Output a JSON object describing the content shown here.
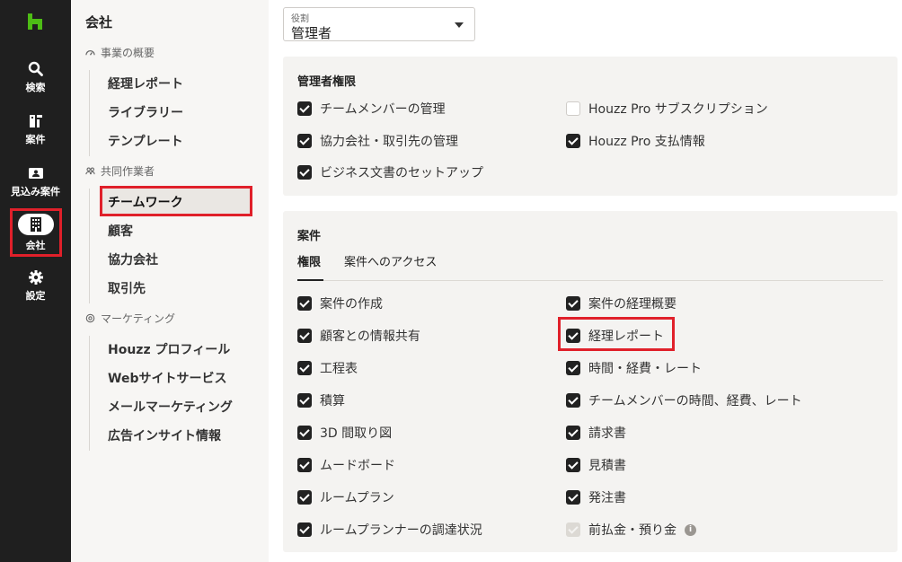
{
  "rail": {
    "items": [
      {
        "label": "検索",
        "icon": "search-icon"
      },
      {
        "label": "案件",
        "icon": "projects-icon"
      },
      {
        "label": "見込み案件",
        "icon": "leads-icon"
      },
      {
        "label": "会社",
        "icon": "building-icon"
      },
      {
        "label": "設定",
        "icon": "gear-icon"
      }
    ]
  },
  "subnav": {
    "heading": "会社",
    "sections": [
      {
        "label": "事業の概要",
        "items": [
          "経理レポート",
          "ライブラリー",
          "テンプレート"
        ]
      },
      {
        "label": "共同作業者",
        "items": [
          "チームワーク",
          "顧客",
          "協力会社",
          "取引先"
        ]
      },
      {
        "label": "マーケティング",
        "items": [
          "Houzz プロフィール",
          "Webサイトサービス",
          "メールマーケティング",
          "広告インサイト情報"
        ]
      }
    ]
  },
  "role": {
    "label": "役割",
    "value": "管理者"
  },
  "admin": {
    "title": "管理者権限",
    "left": [
      {
        "label": "チームメンバーの管理",
        "checked": true
      },
      {
        "label": "協力会社・取引先の管理",
        "checked": true
      },
      {
        "label": "ビジネス文書のセットアップ",
        "checked": true
      }
    ],
    "right": [
      {
        "label": "Houzz Pro サブスクリプション",
        "checked": false
      },
      {
        "label": "Houzz Pro 支払情報",
        "checked": true
      }
    ]
  },
  "projects": {
    "title": "案件",
    "tabs": [
      "権限",
      "案件へのアクセス"
    ],
    "left": [
      {
        "label": "案件の作成",
        "checked": true
      },
      {
        "label": "顧客との情報共有",
        "checked": true
      },
      {
        "label": "工程表",
        "checked": true
      },
      {
        "label": "積算",
        "checked": true
      },
      {
        "label": "3D 間取り図",
        "checked": true
      },
      {
        "label": "ムードボード",
        "checked": true
      },
      {
        "label": "ルームプラン",
        "checked": true
      },
      {
        "label": "ルームプランナーの調達状況",
        "checked": true
      }
    ],
    "right": [
      {
        "label": "案件の経理概要",
        "checked": true
      },
      {
        "label": "経理レポート",
        "checked": true
      },
      {
        "label": "時間・経費・レート",
        "checked": true
      },
      {
        "label": "チームメンバーの時間、経費、レート",
        "checked": true
      },
      {
        "label": "請求書",
        "checked": true
      },
      {
        "label": "見積書",
        "checked": true
      },
      {
        "label": "発注書",
        "checked": true
      },
      {
        "label": "前払金・預り金",
        "checked": true,
        "disabled": true,
        "info": "i"
      }
    ]
  },
  "colors": {
    "rail": "#1f1f1f",
    "brand": "#4dbc15",
    "highlight": "#e0202a",
    "panel": "#f4f3f1"
  }
}
